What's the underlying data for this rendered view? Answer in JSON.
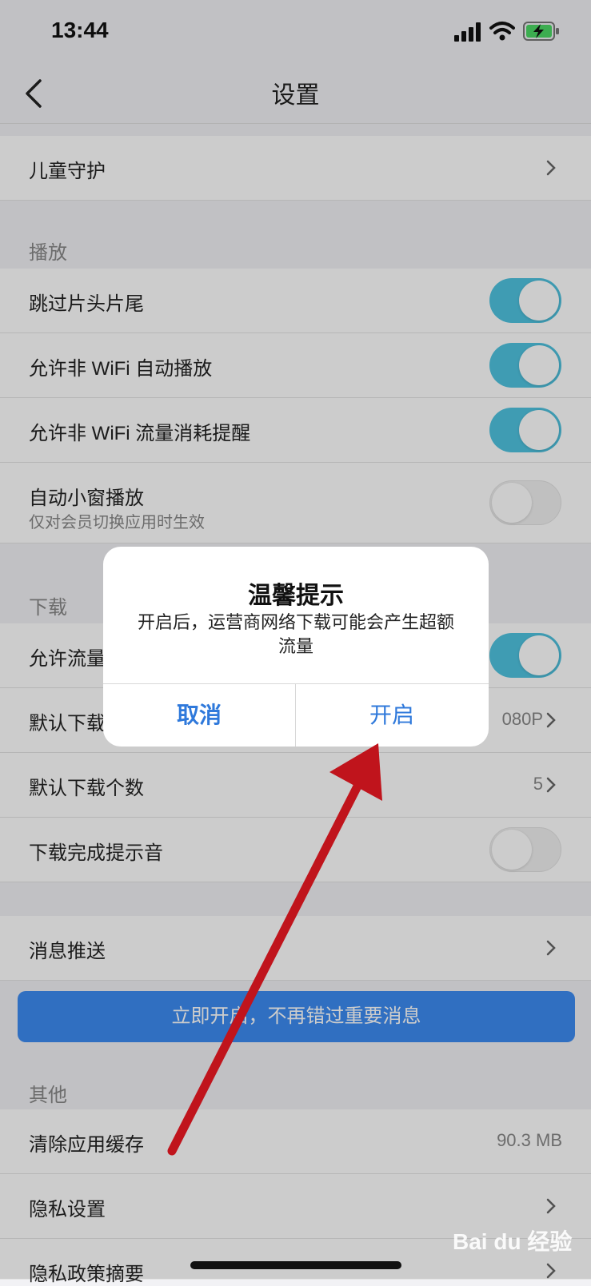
{
  "status_bar": {
    "time": "13:44"
  },
  "nav": {
    "title": "设置"
  },
  "rows": {
    "child_guard": "儿童守护",
    "section_play": "播放",
    "skip_intro": "跳过片头片尾",
    "non_wifi_autoplay": "允许非 WiFi 自动播放",
    "non_wifi_traffic_reminder": "允许非 WiFi 流量消耗提醒",
    "auto_mini_window": "自动小窗播放",
    "auto_mini_window_sub": "仅对会员切换应用时生效",
    "section_download": "下载",
    "allow_traffic_download": "允许流量",
    "default_download": "默认下载",
    "default_download_value": "080P",
    "default_download_count": "默认下载个数",
    "default_download_count_value": "5",
    "download_complete_sound": "下载完成提示音",
    "message_push": "消息推送",
    "section_other": "其他",
    "clear_cache": "清除应用缓存",
    "clear_cache_value": "90.3 MB",
    "privacy_settings": "隐私设置",
    "privacy_policy_summary": "隐私政策摘要"
  },
  "toggles": {
    "skip_intro": true,
    "non_wifi_autoplay": true,
    "non_wifi_traffic_reminder": true,
    "auto_mini_window": false,
    "allow_traffic_download": true,
    "download_complete_sound": false
  },
  "banner": {
    "text": "立即开启，不再错过重要消息"
  },
  "dialog": {
    "title": "温馨提示",
    "message": "开启后，运营商网络下载可能会产生超额流量",
    "cancel_label": "取消",
    "confirm_label": "开启"
  },
  "watermark": {
    "text": "Bai du 经验"
  },
  "colors": {
    "accent": "#2f79db",
    "toggle_on": "#4fc3e0",
    "banner": "#3d8bf2",
    "annotation_arrow": "#c0141c"
  }
}
